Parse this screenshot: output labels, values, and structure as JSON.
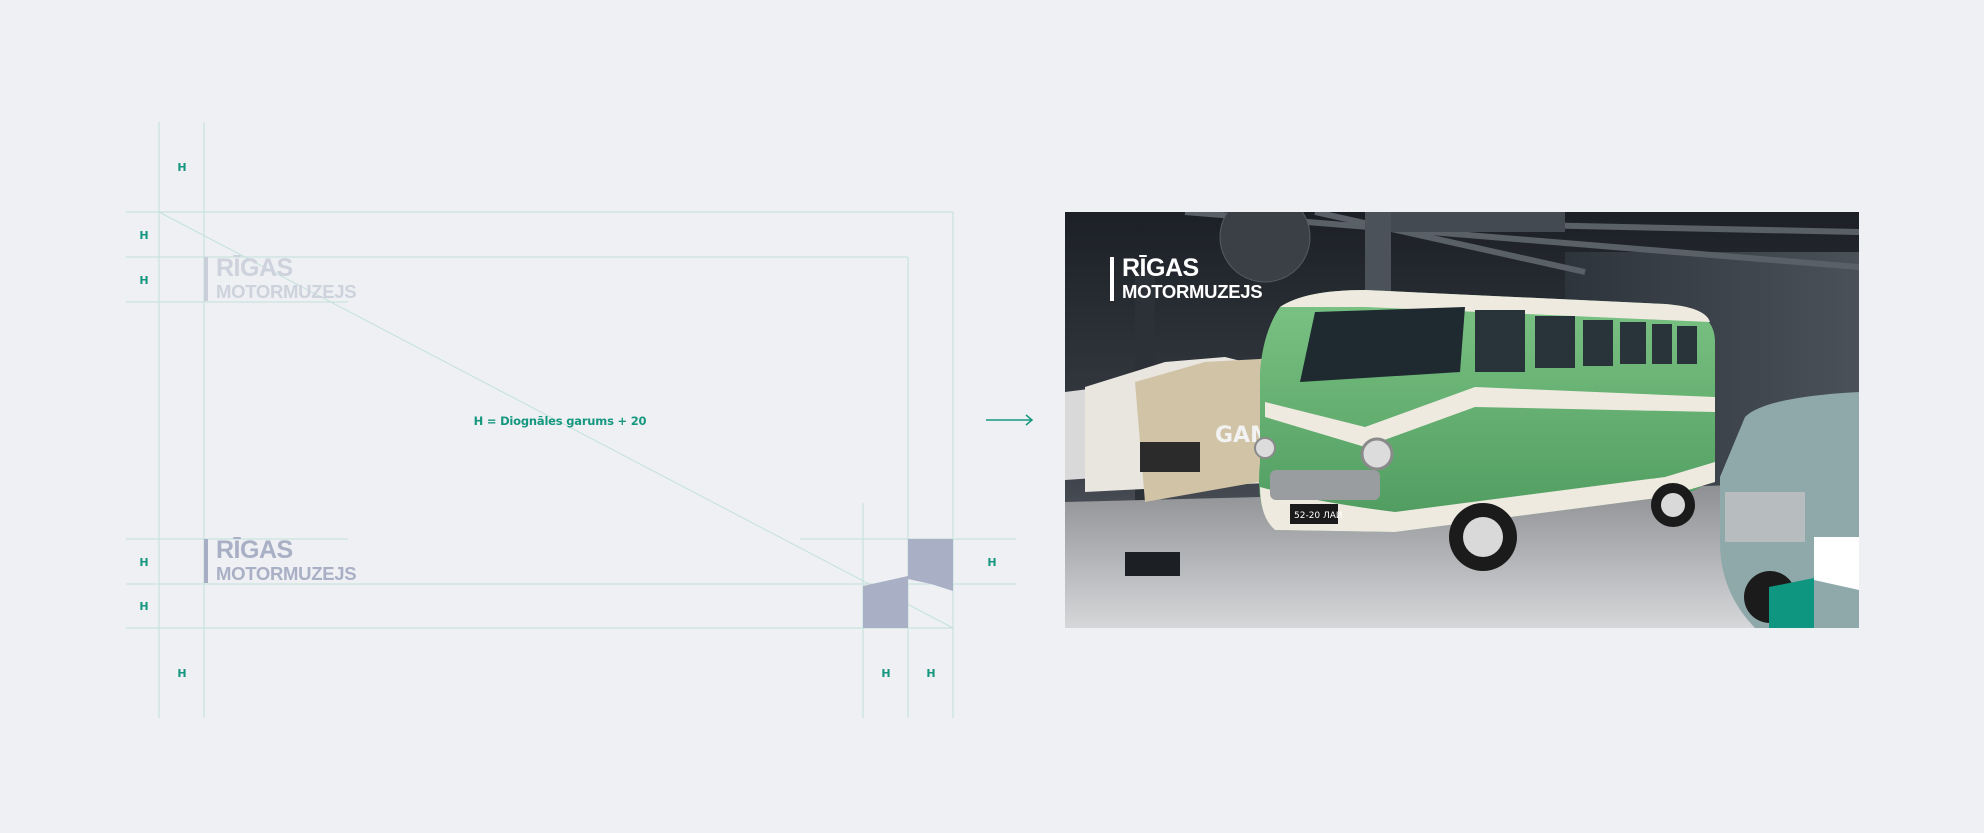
{
  "construction": {
    "h_marker": "H",
    "formula": "H = Diognāles garums + 20"
  },
  "logo": {
    "line1": "RĪGAS",
    "line2": "MOTORMUZEJS"
  },
  "photo": {
    "plate": "52-20 ЛАИ",
    "wall_text": "GAM"
  },
  "colors": {
    "background": "#eef0f3",
    "accent_green": "#16977f",
    "guide_line": "#bfe0da",
    "logo_faint": "#cdd2dc",
    "logo_mid": "#a9b0c5",
    "block_gray": "#a9b0c5"
  }
}
